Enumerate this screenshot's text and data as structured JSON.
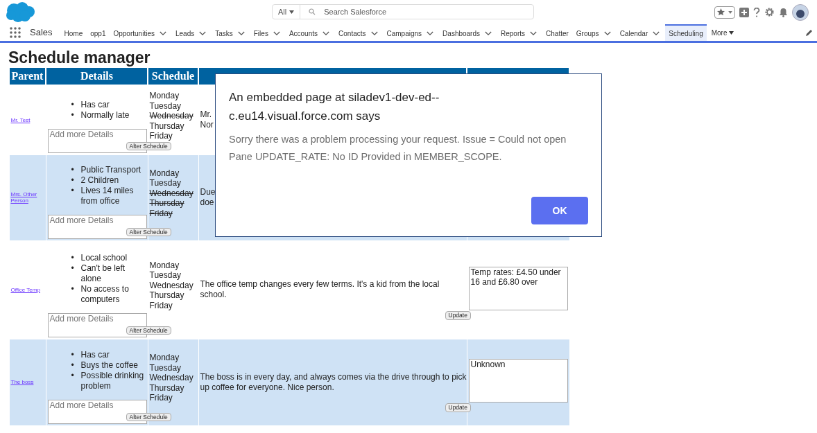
{
  "header": {
    "search_scope": "All",
    "search_placeholder": "Search Salesforce"
  },
  "nav": {
    "app_name": "Sales",
    "items": [
      {
        "label": "Home",
        "dropdown": false,
        "selected": false
      },
      {
        "label": "opp1",
        "dropdown": false,
        "selected": false
      },
      {
        "label": "Opportunities",
        "dropdown": true,
        "selected": false
      },
      {
        "label": "Leads",
        "dropdown": true,
        "selected": false
      },
      {
        "label": "Tasks",
        "dropdown": true,
        "selected": false
      },
      {
        "label": "Files",
        "dropdown": true,
        "selected": false
      },
      {
        "label": "Accounts",
        "dropdown": true,
        "selected": false
      },
      {
        "label": "Contacts",
        "dropdown": true,
        "selected": false
      },
      {
        "label": "Campaigns",
        "dropdown": true,
        "selected": false
      },
      {
        "label": "Dashboards",
        "dropdown": true,
        "selected": false
      },
      {
        "label": "Reports",
        "dropdown": true,
        "selected": false
      },
      {
        "label": "Chatter",
        "dropdown": false,
        "selected": false
      },
      {
        "label": "Groups",
        "dropdown": true,
        "selected": false
      },
      {
        "label": "Calendar",
        "dropdown": true,
        "selected": false
      },
      {
        "label": "Scheduling",
        "dropdown": false,
        "selected": true
      }
    ],
    "more": "More"
  },
  "page_title": "Schedule manager",
  "table": {
    "bullet": "•",
    "columns": [
      "Parent",
      "Details",
      "Schedule"
    ],
    "rows": [
      {
        "parent": "Mr. Test",
        "details": [
          "Has car",
          "Normally late"
        ],
        "details_placeholder": "Add more Details",
        "alter_button": "Alter Schedule",
        "schedule": [
          {
            "day": "Monday",
            "struck": false
          },
          {
            "day": "Tuesday",
            "struck": false
          },
          {
            "day": "Wednesday",
            "struck": true
          },
          {
            "day": "Thursday",
            "struck": false
          },
          {
            "day": "Friday",
            "struck": false
          }
        ],
        "notes": "Mr.\nNor"
      },
      {
        "parent": "Mrs. Other Person",
        "details": [
          "Public Transport",
          "2 Children",
          "Lives 14 miles from office"
        ],
        "details_placeholder": "Add more Details",
        "alter_button": "Alter Schedule",
        "schedule": [
          {
            "day": "Monday",
            "struck": false
          },
          {
            "day": "Tuesday",
            "struck": false
          },
          {
            "day": "Wednesday",
            "struck": true
          },
          {
            "day": "Thursday",
            "struck": true
          },
          {
            "day": "Friday",
            "struck": true
          }
        ],
        "notes": "Due\ndoe"
      },
      {
        "parent": "Office Temp",
        "details": [
          "Local school",
          "Can't be left alone",
          "No access to computers"
        ],
        "details_placeholder": "Add more Details",
        "alter_button": "Alter Schedule",
        "schedule": [
          {
            "day": "Monday",
            "struck": false
          },
          {
            "day": "Tuesday",
            "struck": false
          },
          {
            "day": "Wednesday",
            "struck": false
          },
          {
            "day": "Thursday",
            "struck": false
          },
          {
            "day": "Friday",
            "struck": false
          }
        ],
        "notes": "The office temp changes every few terms. It's a kid from the local school.",
        "rate": "Temp rates: £4.50 under 16 and £6.80 over",
        "update_button": "Update"
      },
      {
        "parent": "The boss",
        "details": [
          "Has car",
          "Buys the coffee",
          "Possible drinking problem"
        ],
        "details_placeholder": "Add more Details",
        "alter_button": "Alter Schedule",
        "schedule": [
          {
            "day": "Monday",
            "struck": false
          },
          {
            "day": "Tuesday",
            "struck": false
          },
          {
            "day": "Wednesday",
            "struck": false
          },
          {
            "day": "Thursday",
            "struck": false
          },
          {
            "day": "Friday",
            "struck": false
          }
        ],
        "notes": "The boss is in every day, and always comes via the drive through to pick up coffee for everyone. Nice person.",
        "rate": "Unknown",
        "update_button": "Update"
      }
    ]
  },
  "dialog": {
    "title": "An embedded page at siladev1-dev-ed--c.eu14.visual.force.com says",
    "message": "Sorry there was a problem processing your request. Issue = Could not open Pane UPDATE_RATE: No ID Provided in MEMBER_SCOPE.",
    "ok_button": "OK"
  }
}
